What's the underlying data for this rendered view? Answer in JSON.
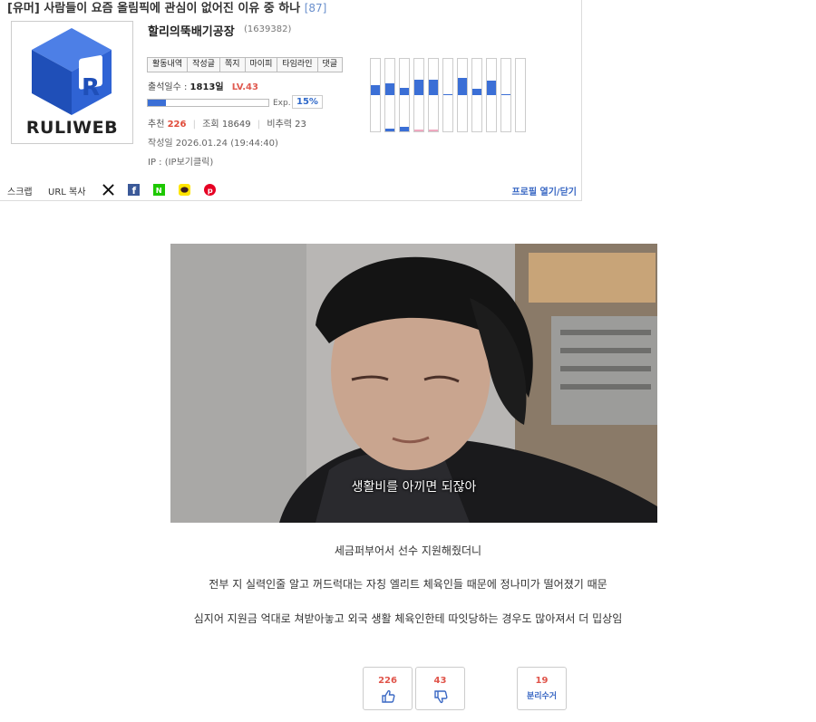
{
  "post": {
    "category": "[유머]",
    "title": "사람들이 요즘 올림픽에 관심이 없어진 이유 중 하나",
    "comment_count": "[87]"
  },
  "profile": {
    "logo_text": "RULIWEB",
    "nickname": "할리의뚝배기공장",
    "user_id": "(1639382)",
    "tabs": [
      "활동내역",
      "작성글",
      "쪽지",
      "마이피",
      "타임라인",
      "댓글"
    ],
    "days_label": "출석일수 :",
    "days_value": "1813일",
    "level": "LV.43",
    "exp_label": "Exp.",
    "exp_percent": "15%",
    "exp_fraction": 0.15,
    "recommend_label": "추천",
    "recommend_value": "226",
    "views_label": "조회",
    "views_value": "18649",
    "ratio_label": "비추력",
    "ratio_value": "23",
    "date_text": "작성일 2026.01.24 (19:44:40)",
    "ip_text": "IP : (IP보기클릭)"
  },
  "toolbar": {
    "scrap": "스크랩",
    "copy_url": "URL 복사",
    "profile_toggle": "프로필 열기/닫기"
  },
  "colors": {
    "accent_blue": "#3b6fd6",
    "red": "#e04b3a",
    "link_blue": "#3a68c4"
  },
  "media": {
    "subtitle": "생활비를 아끼면 되잖아"
  },
  "content": {
    "line1": "세금퍼부어서 선수 지원해줬더니",
    "line2": "전부 지 실력인줄 알고 꺼드럭대는 자칭 엘리트 체육인들 때문에 정나미가 떨어졌기 때문",
    "line3": "심지어 지원금 억대로 쳐받아놓고 외국 생활 체육인한테 따잇당하는 경우도 많아져서 더 밉상임"
  },
  "votes": {
    "up": "226",
    "down": "43",
    "recycle_count": "19",
    "recycle_label": "분리수거"
  }
}
